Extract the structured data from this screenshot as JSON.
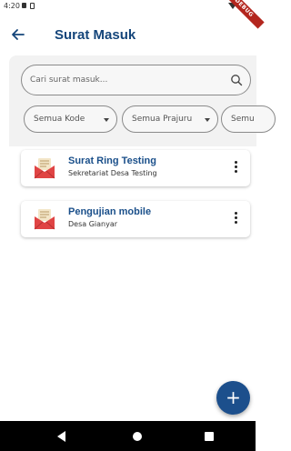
{
  "status_bar": {
    "time": "4:20"
  },
  "debug_banner": "DEBUG",
  "app_bar": {
    "title": "Surat Masuk",
    "back_icon": "arrow-left-icon"
  },
  "search": {
    "placeholder": "Cari surat masuk...",
    "value": "",
    "icon": "search-icon"
  },
  "filters": [
    {
      "label": "Semua Kode"
    },
    {
      "label": "Semua Prajuru"
    },
    {
      "label": "Semu"
    }
  ],
  "letters": [
    {
      "title": "Surat Ring Testing",
      "subtitle": "Sekretariat Desa Testing"
    },
    {
      "title": "Pengujian mobile",
      "subtitle": "Desa Gianyar"
    }
  ],
  "fab": {
    "label": "+"
  },
  "colors": {
    "primary": "#1c4f8c",
    "title": "#14457a",
    "mail_red": "#e04444"
  }
}
